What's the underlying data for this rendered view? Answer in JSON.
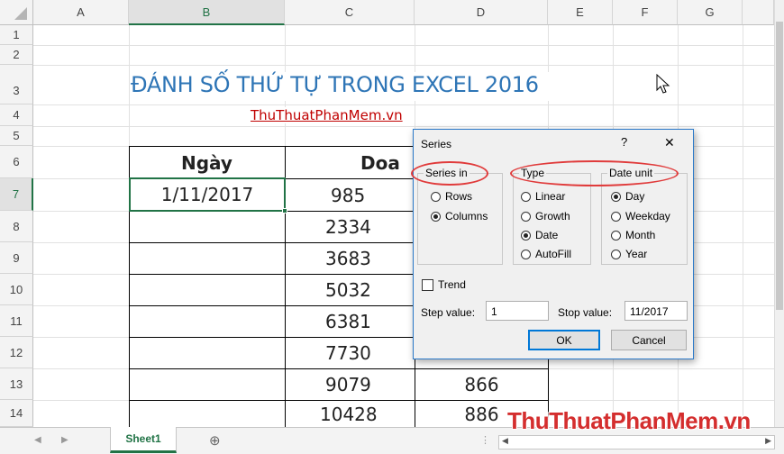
{
  "columns": [
    "A",
    "B",
    "C",
    "D",
    "E",
    "F",
    "G"
  ],
  "rows": [
    "1",
    "2",
    "3",
    "4",
    "5",
    "6",
    "7",
    "8",
    "9",
    "10",
    "11",
    "12",
    "13",
    "14"
  ],
  "title": "ĐÁNH SỐ THỨ TỰ TRONG EXCEL 2016",
  "subtitle": "ThuThuatPhanMem.vn",
  "table": {
    "header_b": "Ngày",
    "header_c": "Doa",
    "b7": "1/11/2017",
    "c_values": [
      "985",
      "2334",
      "3683",
      "5032",
      "6381",
      "7730",
      "9079",
      "10428"
    ],
    "d_values": [
      "866",
      "886"
    ]
  },
  "dialog": {
    "title": "Series",
    "help": "?",
    "close": "✕",
    "series_in": {
      "label": "Series in",
      "options": [
        "Rows",
        "Columns"
      ],
      "selected": "Columns"
    },
    "type": {
      "label": "Type",
      "options": [
        "Linear",
        "Growth",
        "Date",
        "AutoFill"
      ],
      "selected": "Date"
    },
    "date_unit": {
      "label": "Date unit",
      "options": [
        "Day",
        "Weekday",
        "Month",
        "Year"
      ],
      "selected": "Day"
    },
    "trend_label": "Trend",
    "step_label": "Step value:",
    "step_value": "1",
    "stop_label": "Stop value:",
    "stop_value": "11/2017",
    "ok": "OK",
    "cancel": "Cancel"
  },
  "sheet_tab": "Sheet1",
  "add_sheet": "⊕",
  "watermark": "ThuThuatPhanMem.vn",
  "colors": {
    "excel_green": "#217346",
    "title_blue": "#2e75b6",
    "link_red": "#c00000",
    "annotation_red": "#e03b3b"
  }
}
